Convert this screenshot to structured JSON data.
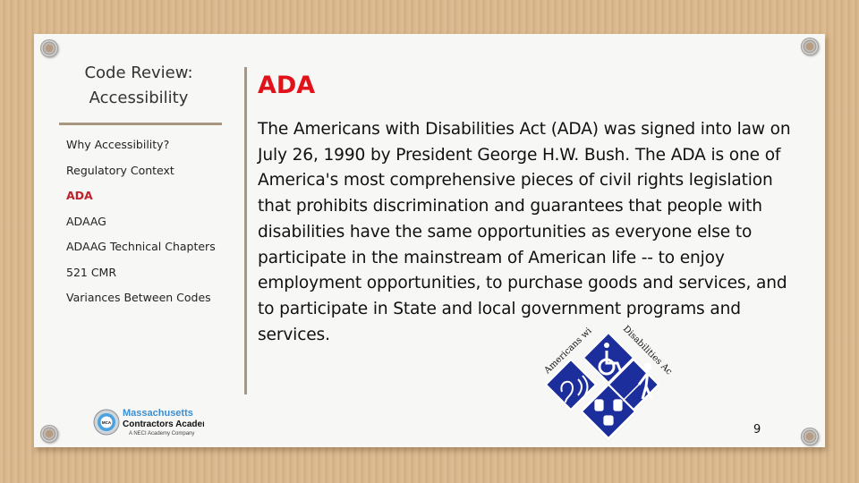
{
  "sidebar": {
    "title": "Code Review: Accessibility",
    "items": [
      {
        "label": "Why Accessibility?",
        "active": false
      },
      {
        "label": "Regulatory Context",
        "active": false
      },
      {
        "label": "ADA",
        "active": true
      },
      {
        "label": "ADAAG",
        "active": false
      },
      {
        "label": "ADAAG Technical Chapters",
        "active": false
      },
      {
        "label": "521 CMR",
        "active": false
      },
      {
        "label": "Variances Between Codes",
        "active": false
      }
    ],
    "logo": {
      "line1": "Massachusetts",
      "line2": "Contractors Academy",
      "line3": "A NECI Academy Company",
      "badge": "MCA"
    }
  },
  "main": {
    "heading": "ADA",
    "paragraph": "The Americans with Disabilities Act (ADA) was signed into law on July 26, 1990 by President George H.W. Bush. The ADA is one of America's most comprehensive pieces of civil rights legislation that prohibits discrimination and guarantees that people with disabilities have the same opportunities as everyone else to participate in the mainstream of American life -- to enjoy employment opportunities, to purchase goods and services, and to participate in State and local government programs and services.",
    "logo": {
      "arc_text_left": "Americans with",
      "arc_text_right": "Disabilities Act",
      "icons": [
        "wheelchair-icon",
        "hearing-icon",
        "blind-cane-icon",
        "sign-language-icon"
      ]
    }
  },
  "page_number": "9",
  "colors": {
    "accent_red": "#e2121a",
    "nav_active": "#c0202a",
    "rule": "#a8977e",
    "logo_blue": "#1c2d9c"
  }
}
